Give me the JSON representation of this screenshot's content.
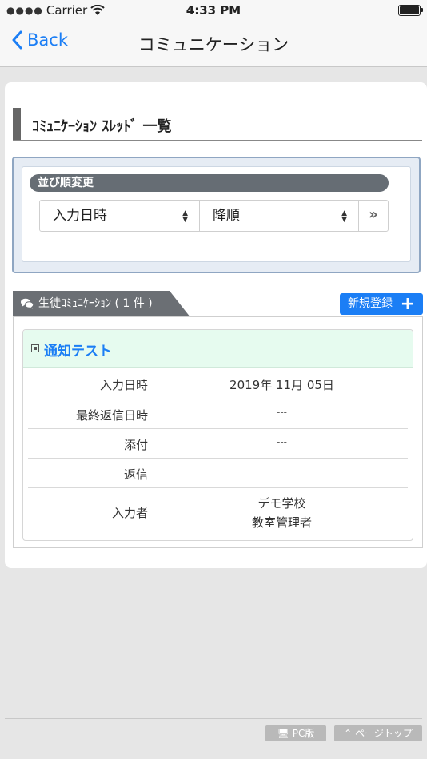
{
  "status_bar": {
    "carrier": "Carrier",
    "time": "4:33 PM"
  },
  "nav": {
    "back_label": "Back",
    "title": "コミュニケーション"
  },
  "section": {
    "title": "ｺﾐｭﾆｹｰｼｮﾝ ｽﾚｯﾄﾞ 一覧"
  },
  "sort": {
    "label": "並び順変更",
    "field_value": "入力日時",
    "order_value": "降順",
    "go_symbol": "»"
  },
  "tab": {
    "label": "生徒ｺﾐｭﾆｹｰｼｮﾝ ( 1 件 )"
  },
  "new_button": {
    "label": "新規登録",
    "plus": "+"
  },
  "item": {
    "title": "通知テスト",
    "rows": [
      {
        "label": "入力日時",
        "value": "2019年 11月 05日"
      },
      {
        "label": "最終返信日時",
        "value": "---"
      },
      {
        "label": "添付",
        "value": "---"
      },
      {
        "label": "返信",
        "value": ""
      },
      {
        "label": "入力者",
        "value_line1": "デモ学校",
        "value_line2": "教室管理者"
      }
    ]
  },
  "footer": {
    "pc_label": "PC版",
    "top_label": "ページトップ"
  },
  "colors": {
    "accent": "#1b7ef5",
    "tab_bg": "#6b6f74",
    "item_head_bg": "#e6fbef"
  }
}
